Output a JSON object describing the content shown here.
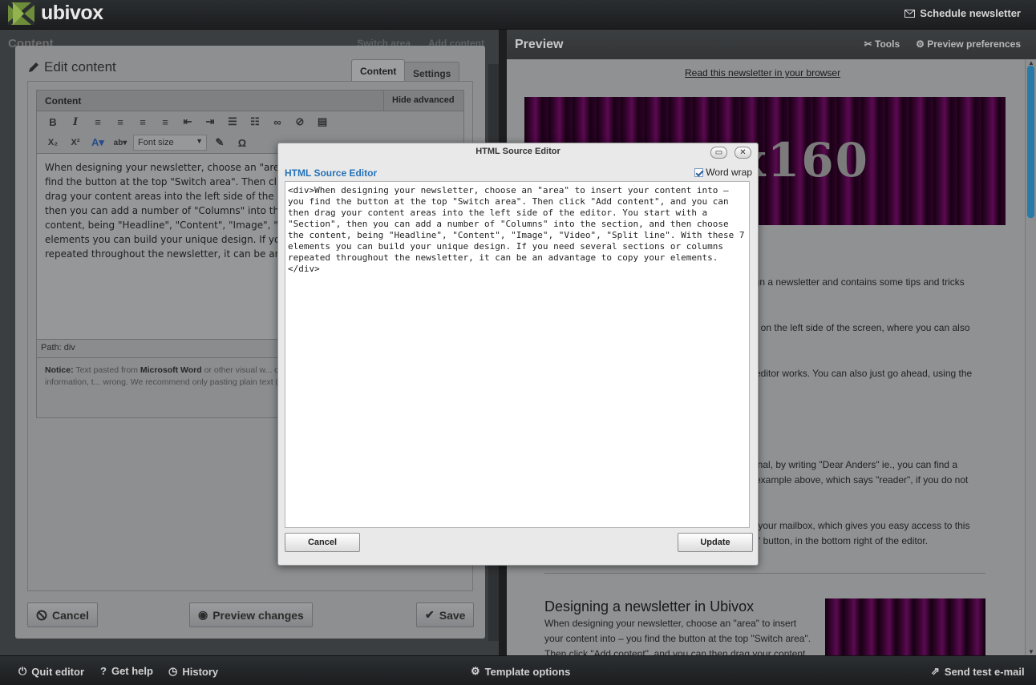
{
  "app": {
    "logo_text": "ubivox",
    "schedule_label": "Schedule newsletter"
  },
  "left_workspace": {
    "title": "Content",
    "switch_area": "Switch area",
    "add_content": "Add content"
  },
  "edit_panel": {
    "title": "Edit content",
    "tabs": [
      "Content",
      "Settings"
    ],
    "content_label": "Content",
    "hide_advanced": "Hide advanced",
    "font_size_placeholder": "Font size",
    "editor_text": "When designing your newsletter, choose an \"area\" to insert your content into – you find the button at the top \"Switch area\". Then click \"Add content\", and you can then drag your content areas into the left side of the editor. You start with a \"Section\", then you can add a number of \"Columns\" into the section, and then choose the content, being \"Headline\", \"Content\", \"Image\", \"Video\", \"Split line\". With these 7 elements you can build your unique design. If you need several sections or columns repeated throughout the newsletter, it can be an advantage to copy your elements.",
    "path_label": "Path:",
    "path_value": "div",
    "notice_label": "Notice:",
    "notice_text": "Text pasted from",
    "notice_word": "Microsoft Word",
    "notice_rest": "or other visual w... contain contain Microsoft specific visual layout information, t... wrong. We recommend only pasting plain text (from notepa...",
    "cancel": "Cancel",
    "preview_changes": "Preview changes",
    "save": "Save"
  },
  "preview": {
    "title": "Preview",
    "tools": "Tools",
    "preferences": "Preview preferences",
    "read_link": "Read this newsletter in your browser",
    "banner_text": "x160",
    "snippets": [
      "sign a newsletter and contains some tips and tricks",
      "ed on the left side of the screen, where you can also",
      "e editor works. You can also just go ahead, using the",
      "sonal, by writing \"Dear Anders\" ie., you can find a",
      "n example above, which says \"reader\", if you do not",
      "to your mailbox, which gives you easy access to this",
      "ail\" button, in the bottom right of the editor."
    ],
    "article_title": "Designing a newsletter in Ubivox",
    "article_body": "When designing your newsletter, choose an \"area\" to insert your content into – you find the button at the top \"Switch area\". Then click \"Add content\", and you can then drag your content"
  },
  "bottom_bar": {
    "quit": "Quit editor",
    "help": "Get help",
    "history": "History",
    "template_options": "Template options",
    "send_test": "Send test e-mail"
  },
  "modal": {
    "title": "HTML Source Editor",
    "heading": "HTML Source Editor",
    "word_wrap": "Word wrap",
    "source": "<div>When designing your newsletter, choose an \"area\" to insert your content into – you find the button at the top \"Switch area\". Then click \"Add content\", and you can then drag your content areas into the left side of the editor. You start with a \"Section\", then you can add a number of \"Columns\" into the section, and then choose the content, being \"Headline\", \"Content\", \"Image\", \"Video\", \"Split line\". With these 7 elements you can build your unique design. If you need several sections or columns repeated throughout the newsletter, it can be an advantage to copy your elements.</div>",
    "cancel": "Cancel",
    "update": "Update"
  }
}
